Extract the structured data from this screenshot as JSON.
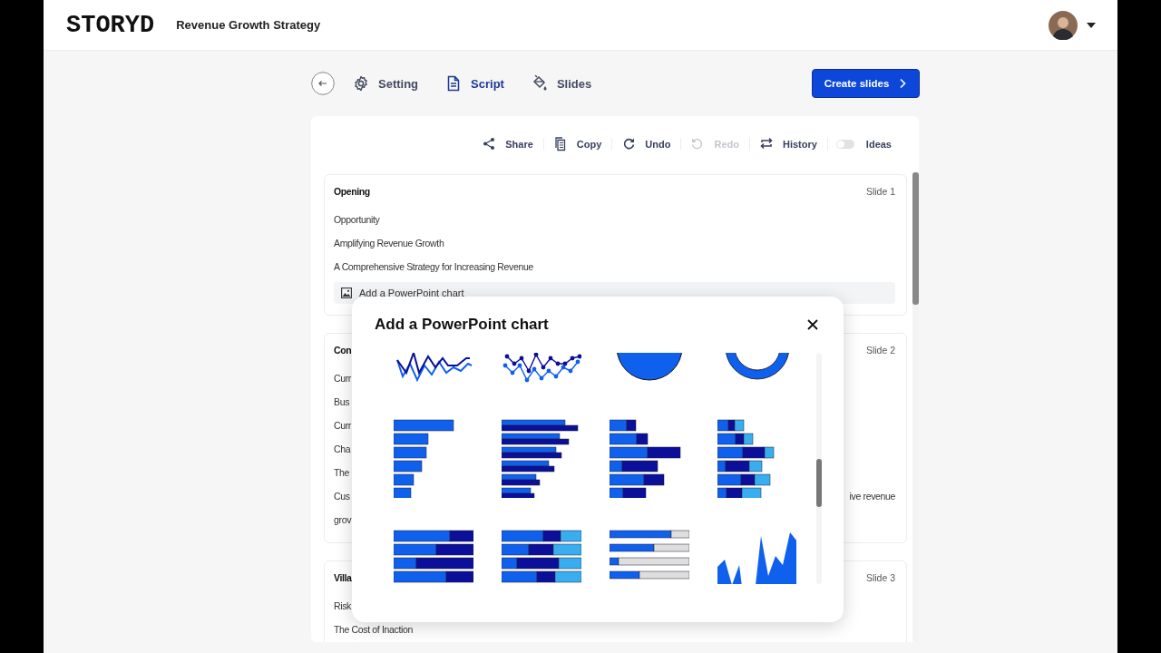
{
  "header": {
    "logo": "STORYD",
    "title": "Revenue Growth Strategy"
  },
  "tabs": [
    {
      "kind": "setting",
      "label": "Setting",
      "selected": false
    },
    {
      "kind": "script",
      "label": "Script",
      "selected": true
    },
    {
      "kind": "slides",
      "label": "Slides",
      "selected": false
    }
  ],
  "create_button": "Create slides",
  "toolbar": [
    {
      "kind": "share",
      "label": "Share",
      "disabled": false
    },
    {
      "kind": "copy",
      "label": "Copy",
      "disabled": false
    },
    {
      "kind": "undo",
      "label": "Undo",
      "disabled": false
    },
    {
      "kind": "redo",
      "label": "Redo",
      "disabled": true
    },
    {
      "kind": "history",
      "label": "History",
      "disabled": false
    },
    {
      "kind": "toggle",
      "label": "Ideas",
      "on": false
    }
  ],
  "sections": [
    {
      "title": "Opening",
      "slide": "Slide 1",
      "lines": [
        {
          "left": "Opportunity"
        },
        {
          "left": "Amplifying Revenue Growth"
        },
        {
          "left": "A Comprehensive Strategy for Increasing Revenue"
        }
      ],
      "chart_button": "Add a PowerPoint chart"
    },
    {
      "title": "Con",
      "slide": "Slide 2",
      "lines": [
        {
          "left": "Curr"
        },
        {
          "left": "Bus"
        },
        {
          "left": "Curr"
        },
        {
          "left": "Cha"
        },
        {
          "left": "The"
        },
        {
          "left": "Cus",
          "right": "ive revenue"
        },
        {
          "left": "grov"
        }
      ]
    },
    {
      "title": "Villa",
      "slide": "Slide 3",
      "lines": [
        {
          "left": "Risk"
        },
        {
          "left": "The Cost of Inaction"
        }
      ]
    }
  ],
  "modal": {
    "title": "Add a PowerPoint chart",
    "charts": [
      {
        "kind": "line"
      },
      {
        "kind": "line-markers"
      },
      {
        "kind": "pie"
      },
      {
        "kind": "donut"
      },
      {
        "kind": "bar"
      },
      {
        "kind": "clustered-bar"
      },
      {
        "kind": "stacked-bar"
      },
      {
        "kind": "stacked-bar-3"
      },
      {
        "kind": "stacked-100"
      },
      {
        "kind": "stacked-100-3"
      },
      {
        "kind": "progress"
      },
      {
        "kind": "area"
      }
    ]
  }
}
